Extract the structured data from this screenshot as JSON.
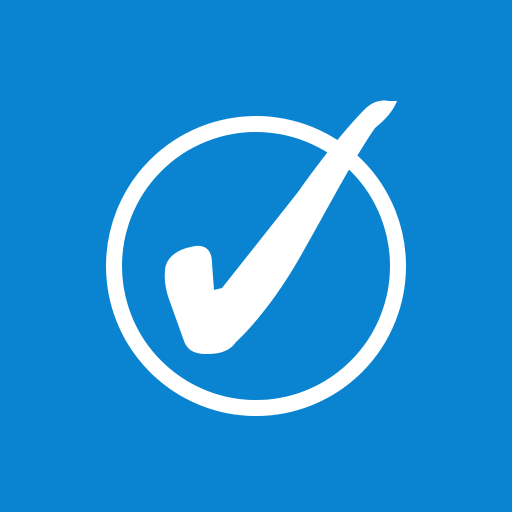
{
  "icon": {
    "name": "check-circle-icon",
    "background_color": "#0A84D0",
    "foreground_color": "#FFFFFF"
  }
}
